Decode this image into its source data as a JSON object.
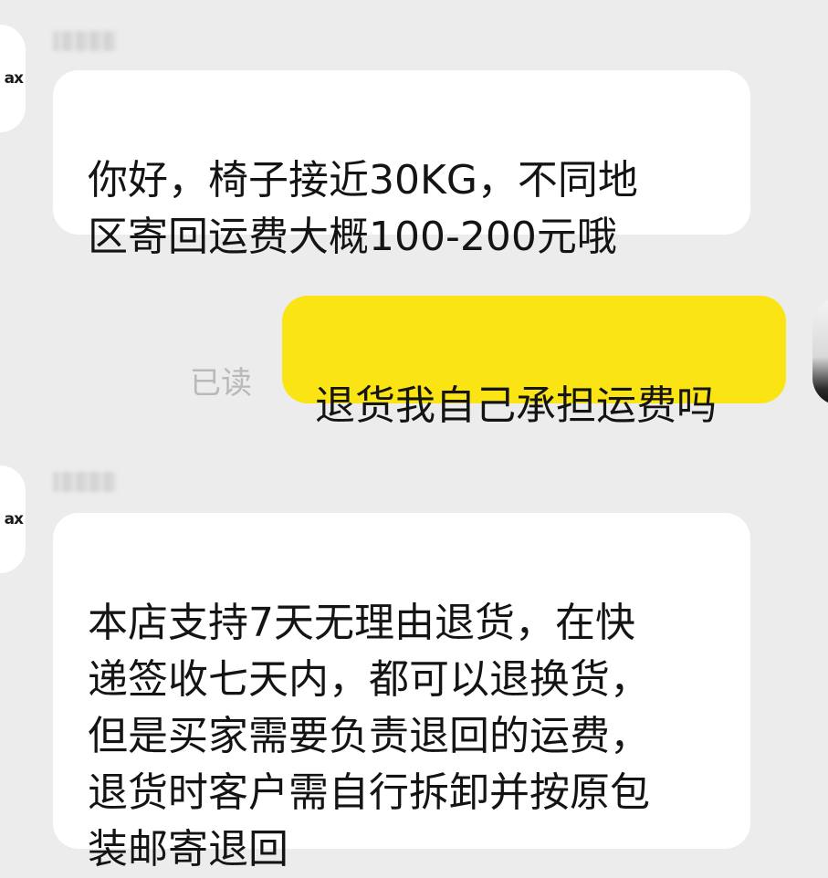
{
  "conversation": {
    "messages": [
      {
        "side": "incoming",
        "sender_logo": "ax",
        "text": "你好，椅子接近30KG，不同地\n区寄回运费大概100-200元哦"
      },
      {
        "side": "outgoing",
        "text": "退货我自己承担运费吗",
        "status": "已读"
      },
      {
        "side": "incoming",
        "sender_logo": "ax",
        "text": "本店支持7天无理由退货，在快\n递签收七天内，都可以退换货，\n但是买家需要负责退回的运费，\n退货时客户需自行拆卸并按原包\n装邮寄退回"
      }
    ]
  },
  "colors": {
    "background": "#ececec",
    "incoming_bubble": "#ffffff",
    "outgoing_bubble": "#fbe414",
    "read_status": "#b9b9b9"
  },
  "icons": {
    "incoming_avatar": "shop-logo-avatar-icon",
    "outgoing_avatar": "user-avatar-icon"
  }
}
